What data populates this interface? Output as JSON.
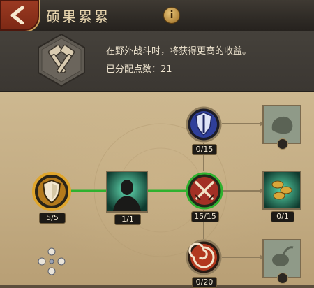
{
  "header": {
    "title": "硕果累累",
    "back_icon": "back-arrow-icon",
    "info_label": "i"
  },
  "info": {
    "description": "在野外战斗时，将获得更高的收益。",
    "points_text": "已分配点数：21",
    "badge_icon": "crossed-hammers-icon"
  },
  "nodes": [
    {
      "id": "shield-base",
      "icon": "shield-icon",
      "count": "5/5",
      "state": "maxed"
    },
    {
      "id": "warrior",
      "icon": "warrior-portrait-icon",
      "count": "1/1",
      "state": "maxed"
    },
    {
      "id": "blue-banner",
      "icon": "blue-shield-sword-icon",
      "count": "0/15",
      "state": "available"
    },
    {
      "id": "crossed-swords",
      "icon": "crossed-swords-icon",
      "count": "15/15",
      "state": "maxed"
    },
    {
      "id": "vortex",
      "icon": "vortex-icon",
      "count": "0/20",
      "state": "available"
    },
    {
      "id": "resources",
      "icon": "resource-chest-icon",
      "count": "",
      "state": "locked"
    },
    {
      "id": "coins",
      "icon": "coins-icon",
      "count": "0/1",
      "state": "available"
    },
    {
      "id": "herb",
      "icon": "herb-icon",
      "count": "",
      "state": "locked"
    }
  ],
  "colors": {
    "active_link": "#2fb12f",
    "inactive_link": "#8e7c5c",
    "gold_ring": "#e0a62c",
    "blue_ring": "#3a4aa8",
    "red_ring": "#a33025",
    "teal_glow": "#3aa58a"
  },
  "dpad_icon": "dpad-navigation-icon"
}
